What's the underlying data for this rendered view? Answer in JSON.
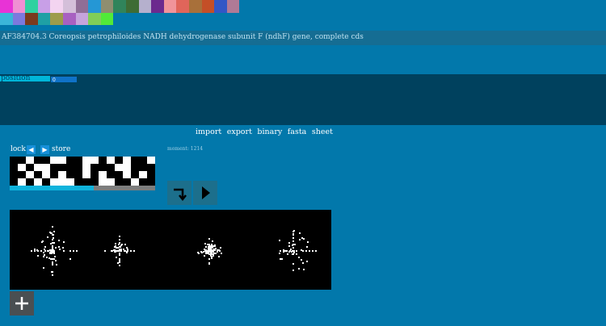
{
  "palette": {
    "row1": [
      "#e833d6",
      "#f08fd3",
      "#2fd1a0",
      "#c89fe7",
      "#f3d4f0",
      "#d4bfd9",
      "#906e96",
      "#2597d5",
      "#8f8e70",
      "#30845b",
      "#3e6c35",
      "#b5b0cd",
      "#6b2a8e",
      "#f0949a",
      "#e0655a",
      "#a8703a",
      "#c44f27",
      "#3157c6",
      "#b07a96"
    ],
    "row2": [
      "#3ab6d9",
      "#7c79de",
      "#7a3a1d",
      "#1ea0a5",
      "#9d9c4b",
      "#a861c1",
      "#c6a4dc",
      "#80ce58",
      "#51ea38"
    ]
  },
  "sequence": {
    "title": "AF384704.3 Coreopsis petrophiloides NADH dehydrogenase subunit F (ndhF) gene, complete cds"
  },
  "position": {
    "label": "position",
    "value": "0"
  },
  "menu": {
    "items": [
      "import",
      "export",
      "binary",
      "fasta",
      "sheet"
    ]
  },
  "controls": {
    "lock_label": "lock",
    "prev_icon": "◀",
    "next_icon": "▶",
    "store_label": "store",
    "moment_text": "moment: 1214",
    "progress": 0.58,
    "step_button": "turn-arrow-icon",
    "play_button": "play-icon",
    "add_button": "plus-icon"
  },
  "pattern": {
    "cols": 18,
    "rows": 4,
    "cells": [
      "110110011001010110",
      "101001111011100111",
      "110101011010110101",
      "101010001110011011"
    ]
  },
  "colors": {
    "background": "#0278ab",
    "panel": "#00415e",
    "accent": "#00b6d9"
  }
}
